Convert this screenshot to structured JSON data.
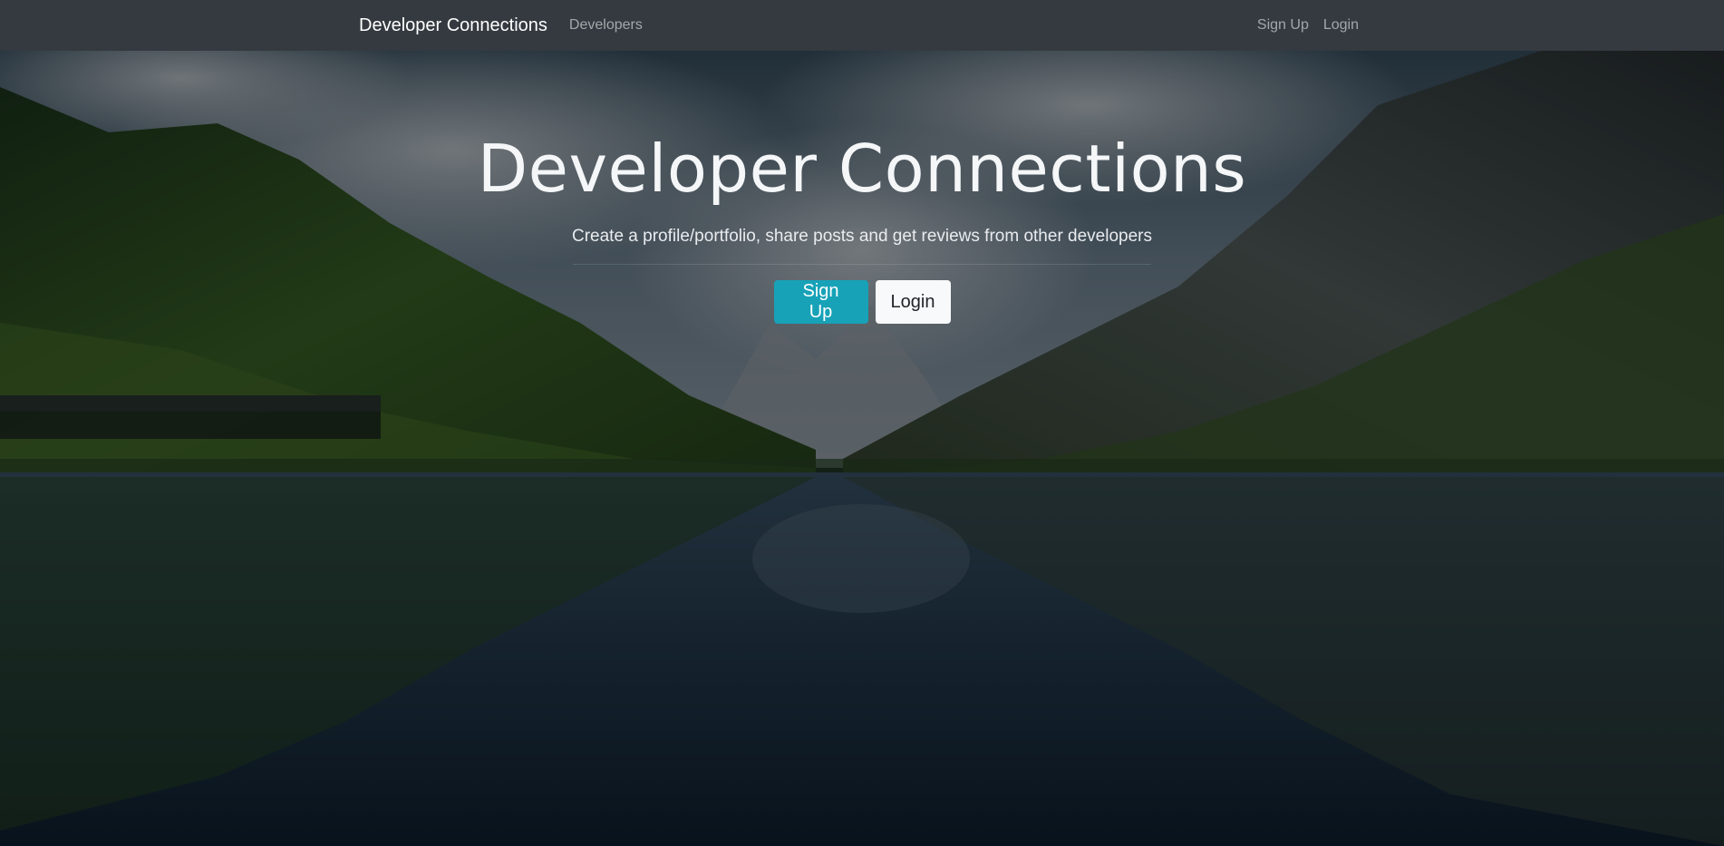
{
  "navbar": {
    "brand": "Developer Connections",
    "left_links": [
      {
        "label": "Developers"
      }
    ],
    "right_links": [
      {
        "label": "Sign Up"
      },
      {
        "label": "Login"
      }
    ],
    "background": "#343a40"
  },
  "hero": {
    "title": "Developer Connections",
    "lead": "Create a profile/portfolio, share posts and get reviews from other developers",
    "buttons": {
      "signup_label": "Sign Up",
      "login_label": "Login"
    },
    "background_image": "mountain-lake-landscape",
    "colors": {
      "signup_button": "#17a2b8",
      "login_button": "#f8f9fa"
    }
  }
}
